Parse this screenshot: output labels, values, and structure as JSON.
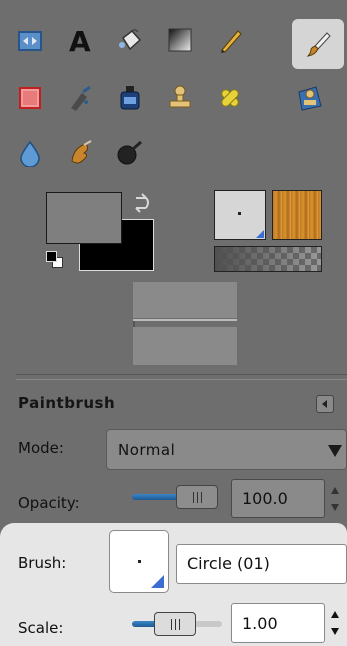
{
  "tools": [
    {
      "name": "align-tool",
      "active": false
    },
    {
      "name": "text-tool",
      "active": false
    },
    {
      "name": "bucket-fill-tool",
      "active": false
    },
    {
      "name": "blend-tool",
      "active": false
    },
    {
      "name": "pencil-tool",
      "active": false
    },
    {
      "name": "paintbrush-tool",
      "active": true
    },
    {
      "name": "eraser-tool",
      "active": false
    },
    {
      "name": "airbrush-tool",
      "active": false
    },
    {
      "name": "ink-tool",
      "active": false
    },
    {
      "name": "clone-tool",
      "active": false
    },
    {
      "name": "healing-tool",
      "active": false
    },
    {
      "name": "perspective-clone-tool",
      "active": false
    },
    {
      "name": "blur-sharpen-tool",
      "active": false
    },
    {
      "name": "smudge-tool",
      "active": false
    },
    {
      "name": "dodge-burn-tool",
      "active": false
    }
  ],
  "colors": {
    "foreground": "#7f7f7f",
    "background": "#000000",
    "active_highlight": "#d5d5d5",
    "slider_accent": "#2f75b5"
  },
  "tool_options": {
    "title": "Paintbrush",
    "mode_label": "Mode:",
    "mode_value": "Normal",
    "opacity_label": "Opacity:",
    "opacity_value": "100.0",
    "opacity_fraction": 1.0,
    "brush_label": "Brush:",
    "brush_value": "Circle (01)",
    "scale_label": "Scale:",
    "scale_value": "1.00",
    "scale_fraction": 0.1
  }
}
